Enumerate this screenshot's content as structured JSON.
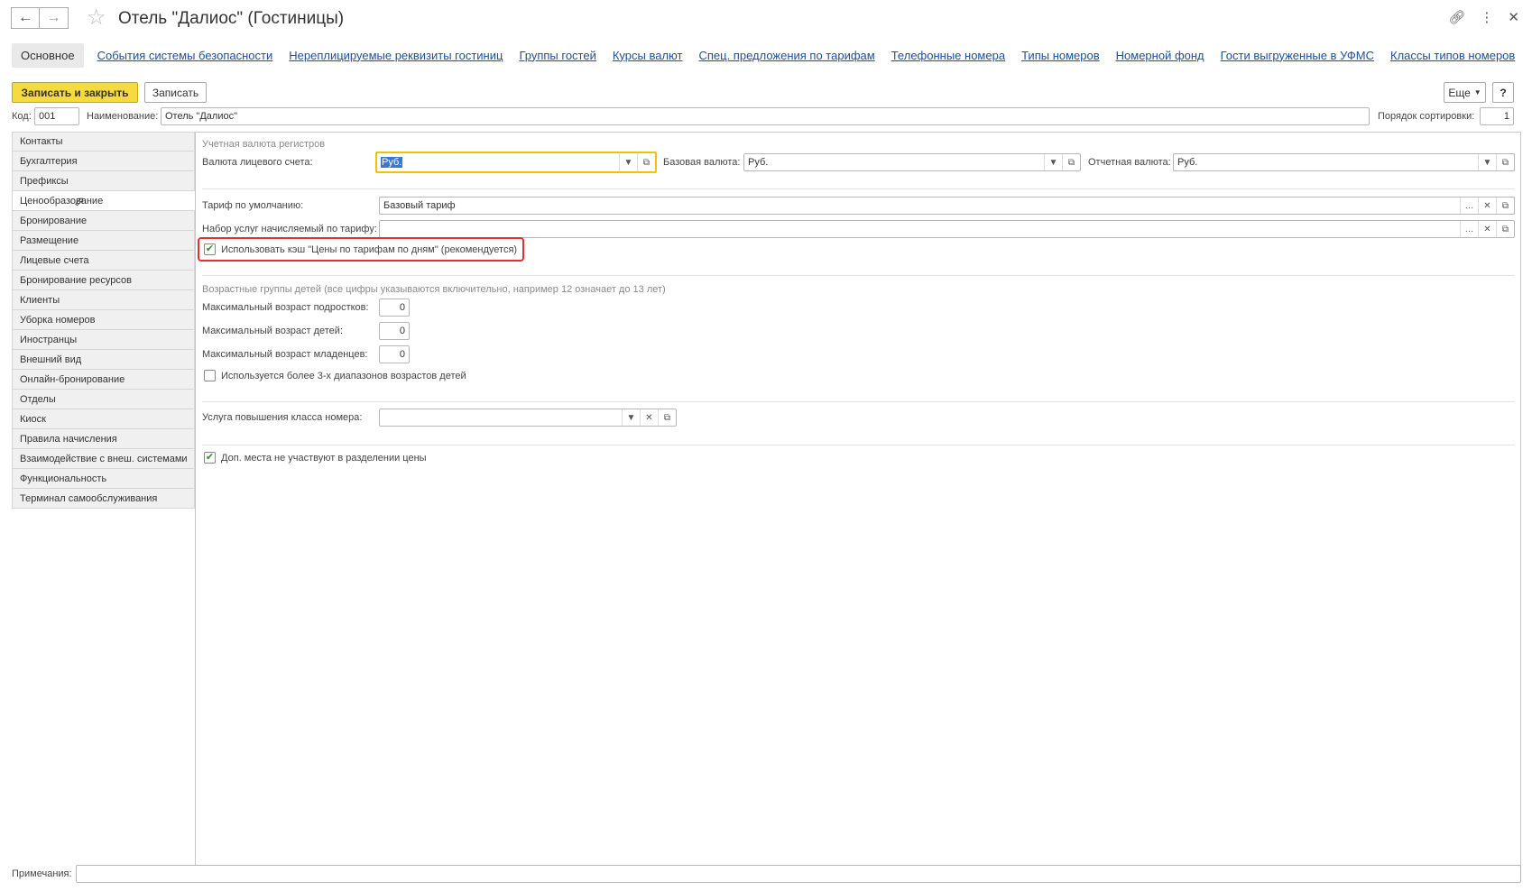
{
  "window": {
    "title": "Отель \"Далиос\" (Гостиницы)"
  },
  "tabs": {
    "active": "Основное",
    "links": [
      "События системы безопасности",
      "Нереплицируемые реквизиты гостиниц",
      "Группы гостей",
      "Курсы валют",
      "Спец. предложения по тарифам",
      "Телефонные номера",
      "Типы номеров",
      "Номерной фонд",
      "Гости выгруженные в УФМС",
      "Классы типов номеров"
    ]
  },
  "toolbar": {
    "save_close": "Записать и закрыть",
    "save": "Записать",
    "more": "Еще",
    "help": "?"
  },
  "header_fields": {
    "code_label": "Код:",
    "code_value": "001",
    "name_label": "Наименование:",
    "name_value": "Отель \"Далиос\"",
    "sort_label": "Порядок сортировки:",
    "sort_value": "1"
  },
  "sidebar": {
    "active_index": 3,
    "items": [
      "Контакты",
      "Бухгалтерия",
      "Префиксы",
      "Ценообразование",
      "Бронирование",
      "Размещение",
      "Лицевые счета",
      "Бронирование ресурсов",
      "Клиенты",
      "Уборка номеров",
      "Иностранцы",
      "Внешний вид",
      "Онлайн-бронирование",
      "Отделы",
      "Киоск",
      "Правила начисления",
      "Взаимодействие с внеш. системами",
      "Функциональность",
      "Терминал самообслуживания"
    ]
  },
  "pricing": {
    "currency_section": "Учетная валюта регистров",
    "account_currency_label": "Валюта лицевого счета:",
    "account_currency_value": "Руб.",
    "base_currency_label": "Базовая валюта:",
    "base_currency_value": "Руб.",
    "report_currency_label": "Отчетная валюта:",
    "report_currency_value": "Руб.",
    "default_tariff_label": "Тариф по умолчанию:",
    "default_tariff_value": "Базовый тариф",
    "services_set_label": "Набор услуг начисляемый по тарифу:",
    "services_set_value": "",
    "use_cache_label": "Использовать кэш \"Цены по тарифам по дням\" (рекомендуется)",
    "use_cache_checked": true,
    "age_section": "Возрастные группы детей (все цифры указываются включительно, например 12 означает до 13 лет)",
    "teen_age_label": "Максимальный возраст подростков:",
    "teen_age_value": "0",
    "child_age_label": "Максимальный возраст детей:",
    "child_age_value": "0",
    "infant_age_label": "Максимальный возраст младенцев:",
    "infant_age_value": "0",
    "more_ranges_label": "Используется более 3-х диапазонов возрастов детей",
    "more_ranges_checked": false,
    "upgrade_service_label": "Услуга повышения класса номера:",
    "upgrade_service_value": "",
    "extra_beds_label": "Доп. места не участвуют в разделении цены",
    "extra_beds_checked": true
  },
  "footer": {
    "notes_label": "Примечания:",
    "notes_value": ""
  },
  "colors": {
    "primary_button": "#f7d940",
    "link": "#1c4f9c",
    "highlight": "#e0312f",
    "focus": "#f2c200"
  }
}
